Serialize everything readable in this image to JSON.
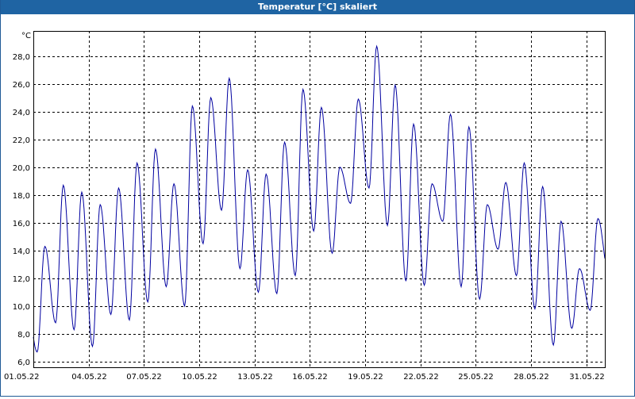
{
  "window": {
    "title": "Temperatur [°C] skaliert"
  },
  "colors": {
    "titlebar": "#1f64a3",
    "series": "#0000a0",
    "grid": "#000000"
  },
  "chart_data": {
    "type": "line",
    "title": "Temperatur [°C] skaliert",
    "ylabel": "°C",
    "xlabel": "",
    "grid": true,
    "xlim": [
      "2022-05-01",
      "2022-06-01"
    ],
    "ylim": [
      5.6,
      29.8
    ],
    "y_ticks": [
      6.0,
      8.0,
      10.0,
      12.0,
      14.0,
      16.0,
      18.0,
      20.0,
      22.0,
      24.0,
      26.0,
      28.0
    ],
    "x_ticks": [
      "01.05.22",
      "04.05.22",
      "07.05.22",
      "10.05.22",
      "13.05.22",
      "16.05.22",
      "19.05.22",
      "22.05.22",
      "25.05.22",
      "28.05.22",
      "31.05.22"
    ],
    "series": [
      {
        "name": "",
        "x": [
          "2022-05-01",
          "2022-05-02",
          "2022-05-03",
          "2022-05-04",
          "2022-05-05",
          "2022-05-06",
          "2022-05-07",
          "2022-05-08",
          "2022-05-09",
          "2022-05-10",
          "2022-05-11",
          "2022-05-12",
          "2022-05-13",
          "2022-05-14",
          "2022-05-15",
          "2022-05-16",
          "2022-05-17",
          "2022-05-18",
          "2022-05-19",
          "2022-05-20",
          "2022-05-21",
          "2022-05-22",
          "2022-05-23",
          "2022-05-24",
          "2022-05-25",
          "2022-05-26",
          "2022-05-27",
          "2022-05-28",
          "2022-05-29",
          "2022-05-30",
          "2022-05-31",
          "2022-06-01"
        ],
        "min": [
          6.7,
          8.8,
          8.3,
          7.1,
          9.4,
          9.0,
          10.3,
          11.4,
          10.0,
          14.5,
          16.9,
          12.7,
          11.0,
          10.9,
          12.2,
          15.4,
          13.8,
          17.4,
          18.5,
          15.8,
          11.8,
          11.5,
          16.1,
          11.4,
          10.5,
          14.1,
          12.2,
          9.8,
          7.2,
          8.4,
          9.7,
          12.3
        ],
        "max": [
          14.3,
          18.7,
          18.2,
          17.3,
          18.5,
          20.3,
          21.3,
          18.8,
          24.4,
          25.0,
          26.4,
          19.8,
          19.5,
          21.8,
          25.6,
          24.3,
          20.0,
          24.9,
          28.7,
          25.9,
          23.1,
          18.8,
          23.8,
          22.9,
          17.3,
          18.9,
          20.3,
          18.6,
          16.1,
          12.7,
          16.3,
          18.1
        ]
      }
    ]
  }
}
